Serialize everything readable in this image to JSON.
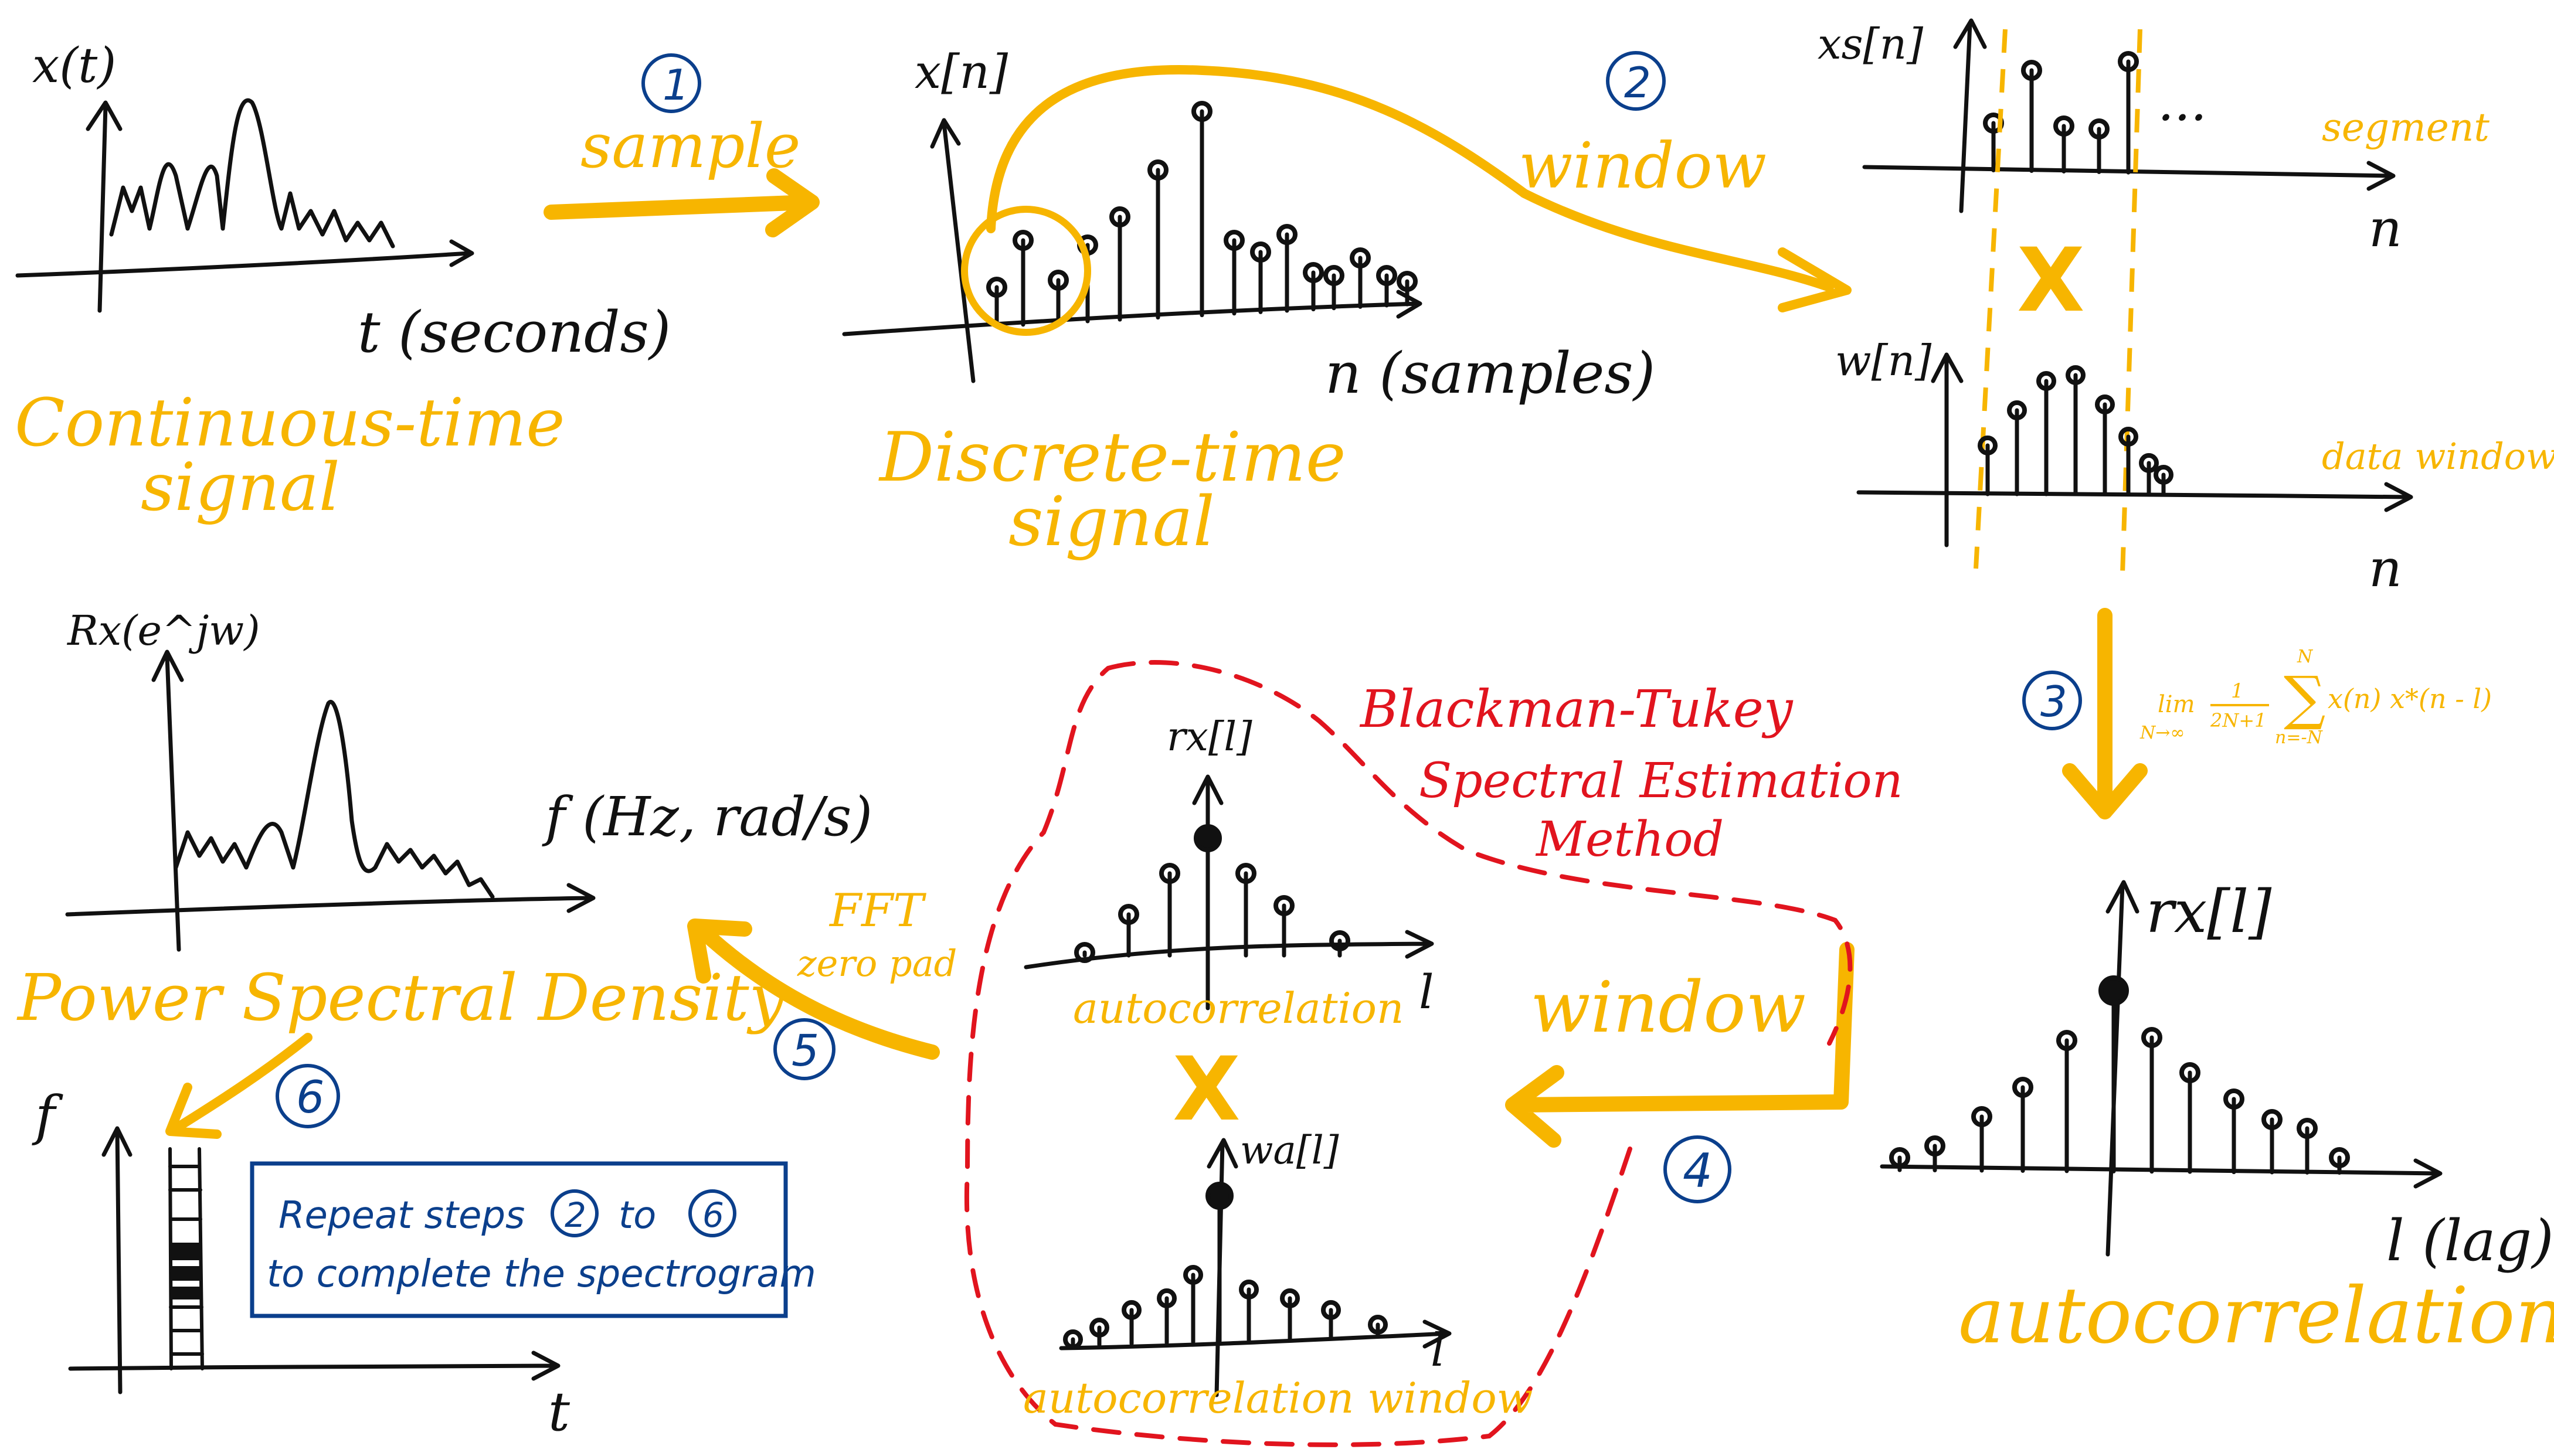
{
  "colors": {
    "accent": "#f7b500",
    "ink": "#111111",
    "method": "#e1141e",
    "step": "#0b3f8c"
  },
  "panels": {
    "continuous": {
      "y_label": "x(t)",
      "x_label": "t (seconds)",
      "caption_line1": "Continuous-time",
      "caption_line2": "signal"
    },
    "discrete": {
      "y_label": "x[n]",
      "x_label": "n (samples)",
      "caption_line1": "Discrete-time",
      "caption_line2": "signal"
    },
    "segment": {
      "y_label": "xs[n]",
      "ellipsis": "...",
      "side_label": "segment",
      "x_label": "n"
    },
    "data_window": {
      "y_label": "w[n]",
      "side_label": "data window",
      "x_label": "n"
    },
    "multiply_symbol": "X",
    "autocorr_big": {
      "y_label": "rx[l]",
      "x_label": "l (lag)",
      "caption": "autocorrelation"
    },
    "method_box": {
      "title_line1": "Blackman-Tukey",
      "title_line2": "Spectral Estimation",
      "title_line3": "Method",
      "top_y_label": "rx[l]",
      "top_x_label": "l",
      "top_caption": "autocorrelation",
      "multiply_symbol": "X",
      "bottom_y_label": "wa[l]",
      "bottom_x_label": "l",
      "bottom_caption": "autocorrelation window"
    },
    "psd": {
      "y_label": "Rx(e^jw)",
      "x_label": "f (Hz, rad/s)",
      "caption": "Power Spectral Density"
    },
    "spectrogram": {
      "y_label": "f",
      "x_label": "t"
    }
  },
  "steps": {
    "s1": {
      "number": "1",
      "label": "sample"
    },
    "s2": {
      "number": "2",
      "label": "window"
    },
    "s3": {
      "number": "3",
      "formula_lim": "lim",
      "formula_sub": "N→∞",
      "formula_frac_top": "1",
      "formula_frac_bottom": "2N+1",
      "formula_sum_top": "N",
      "formula_sum_bottom": "n=-N",
      "formula_body": "x(n) x*(n - l)"
    },
    "s4": {
      "number": "4",
      "label": "window"
    },
    "s5": {
      "number": "5",
      "label_line1": "FFT",
      "label_line2": "zero pad"
    },
    "s6": {
      "number": "6"
    }
  },
  "note": {
    "line1_a": "Repeat steps",
    "line1_step_a": "2",
    "line1_b": "to",
    "line1_step_b": "6",
    "line2": "to complete the spectrogram"
  }
}
